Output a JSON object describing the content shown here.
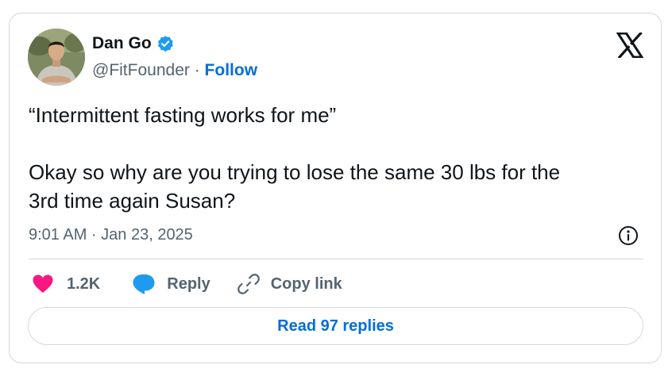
{
  "author": {
    "name": "Dan Go",
    "handle": "@FitFounder",
    "separator": " · ",
    "follow_label": "Follow",
    "verified": true
  },
  "tweet": {
    "text": "“Intermittent fasting works for me”\n\nOkay so why are you trying to lose the same 30 lbs for the\n3rd time again Susan?",
    "timestamp": "9:01 AM · Jan 23, 2025"
  },
  "actions": {
    "likes_count": "1.2K",
    "reply_label": "Reply",
    "copy_link_label": "Copy link"
  },
  "read_replies_label": "Read 97 replies",
  "icons": {
    "brand": "x-logo-icon",
    "verified": "verified-badge-icon",
    "info": "info-icon",
    "like": "heart-icon",
    "reply": "speech-bubble-icon",
    "copy": "link-icon"
  },
  "colors": {
    "link_blue": "#006fd6",
    "verified_blue": "#1d9bf0",
    "heart_pink": "#f91880",
    "text_primary": "#0f1419",
    "text_secondary": "#536471",
    "border": "#cfd9de"
  }
}
